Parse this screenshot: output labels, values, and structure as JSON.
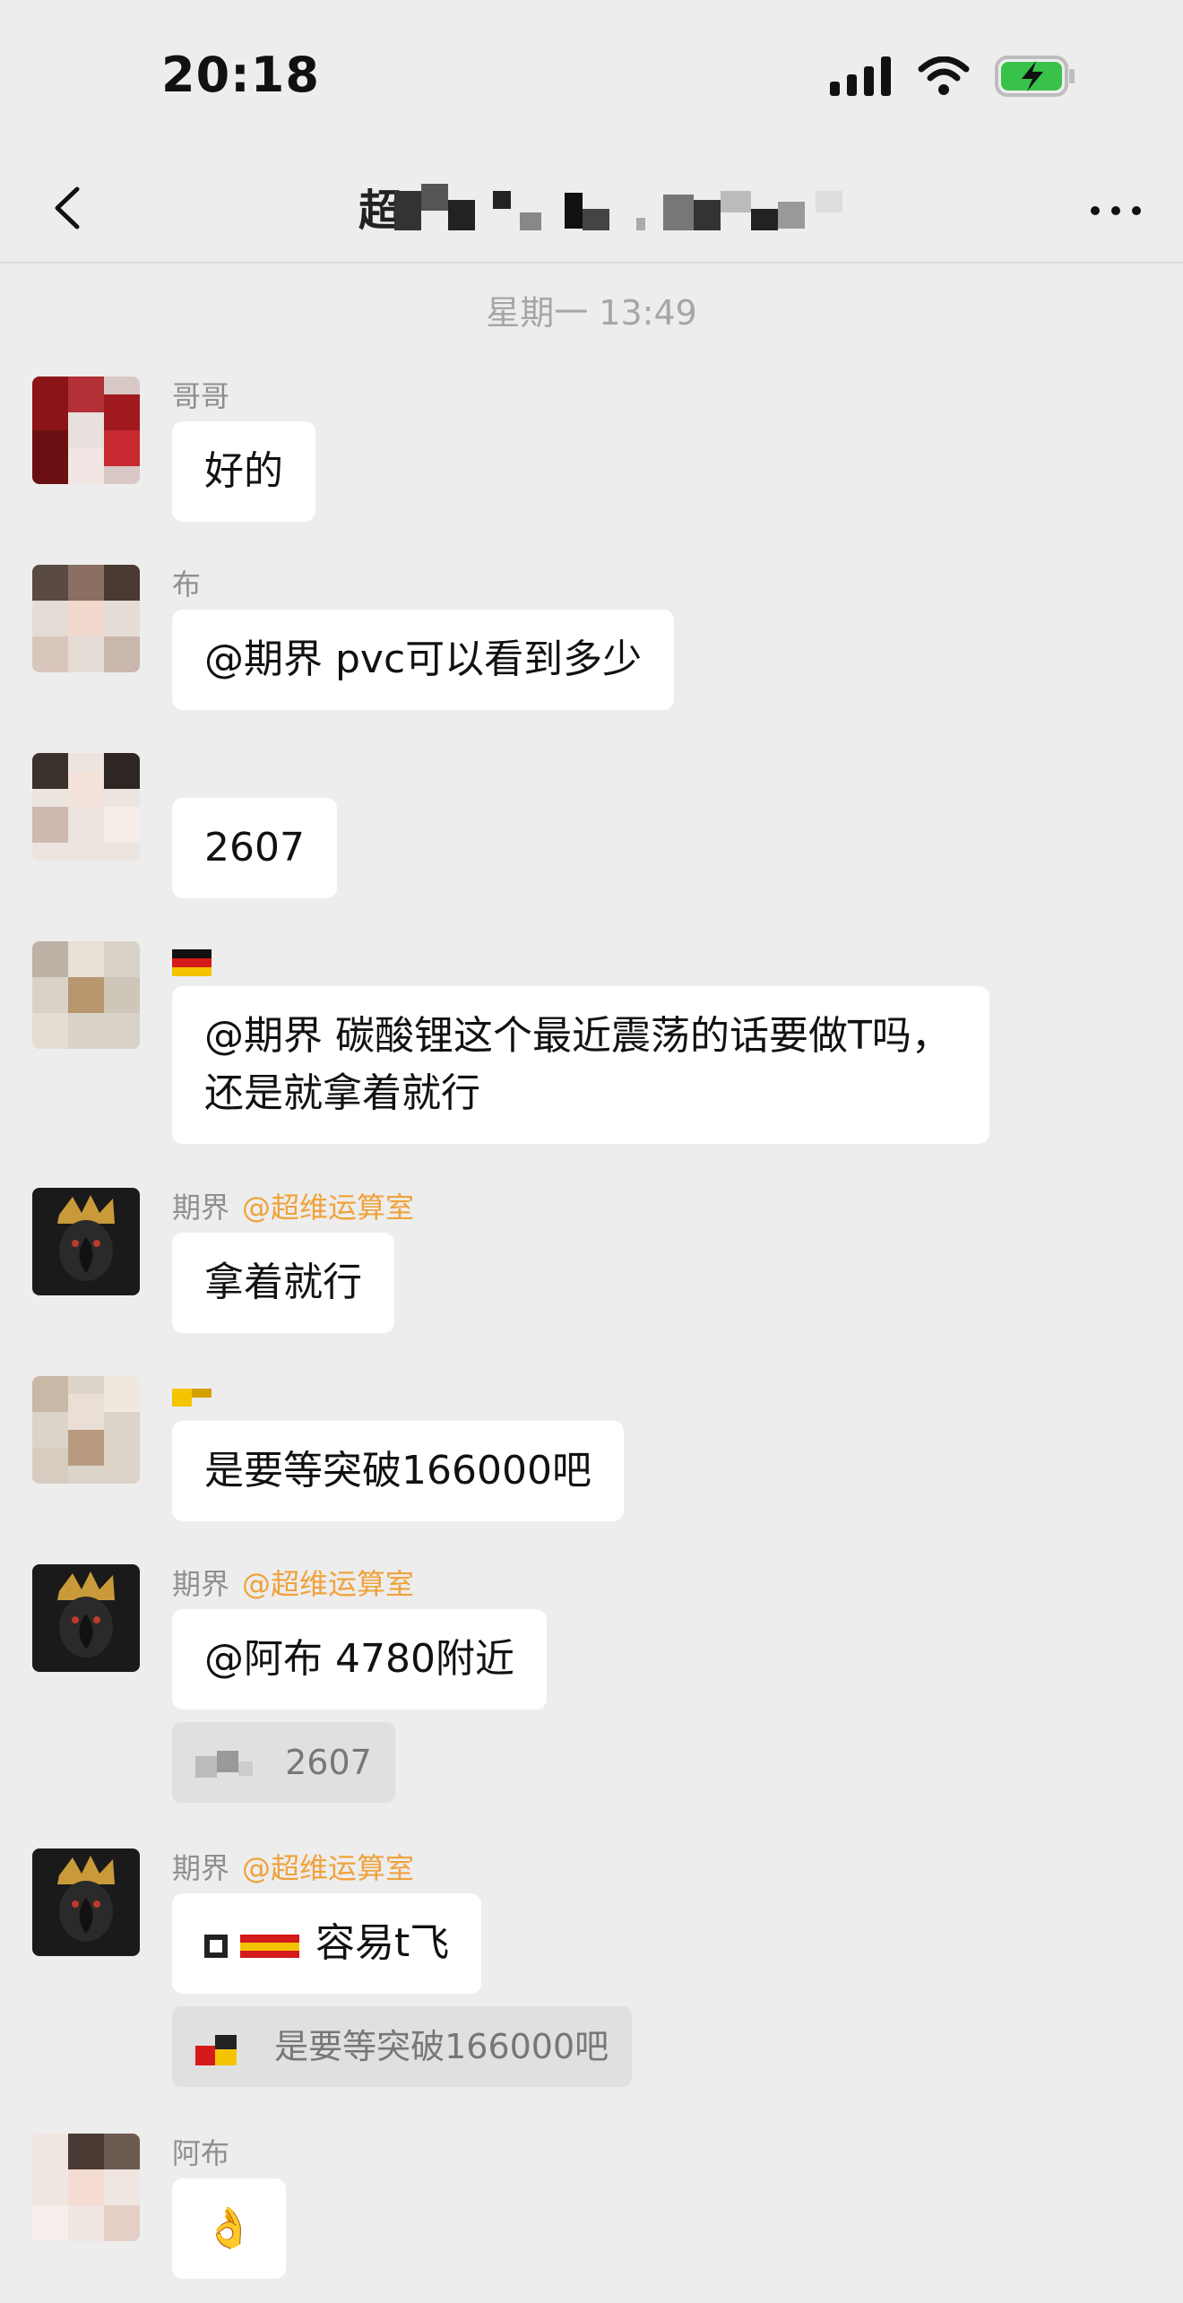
{
  "status": {
    "time": "20:18"
  },
  "nav": {
    "title": "超"
  },
  "timestamp": "星期一 13:49",
  "messages": [
    {
      "sender": "哥哥",
      "text": "好的"
    },
    {
      "sender": "布",
      "text": "@期界 pvc可以看到多少"
    },
    {
      "text": "2607"
    },
    {
      "text": "@期界 碳酸锂这个最近震荡的话要做T吗，还是就拿着就行"
    },
    {
      "sender": "期界",
      "tag": "@超维运算室",
      "text": "拿着就行"
    },
    {
      "text": "是要等突破166000吧"
    },
    {
      "sender": "期界",
      "tag": "@超维运算室",
      "text": "@阿布 4780附近",
      "quote": "2607"
    },
    {
      "sender": "期界",
      "tag": "@超维运算室",
      "text": "容易t飞",
      "quote": "是要等突破166000吧"
    },
    {
      "sender": "阿布",
      "text": "👌"
    }
  ],
  "colors": {
    "background": "#ededed",
    "bubble": "#ffffff",
    "tag": "#f0a23b",
    "battery": "#39c24a"
  }
}
